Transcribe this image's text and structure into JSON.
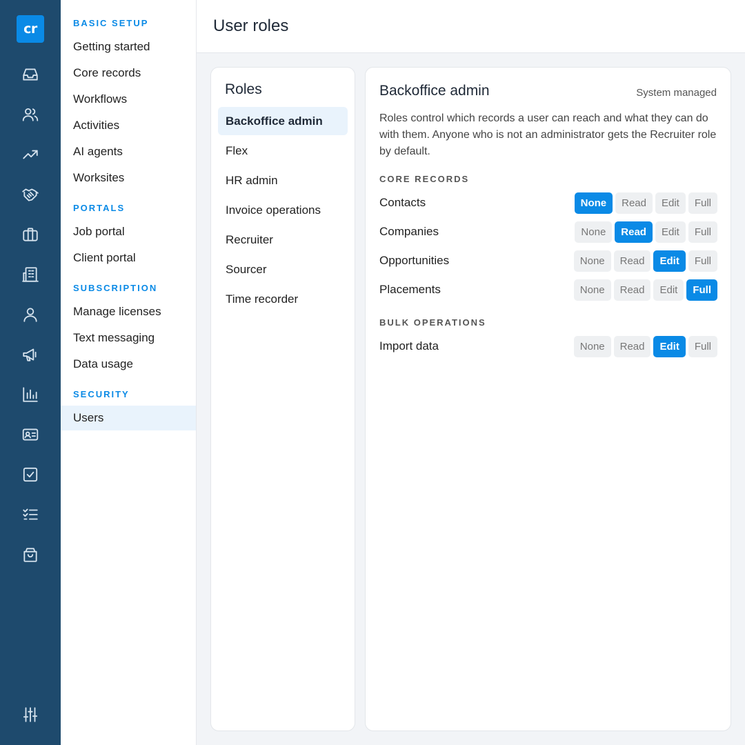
{
  "app": {
    "logo_text": "cr"
  },
  "rail": {
    "icons": [
      "inbox-icon",
      "users-icon",
      "trend-icon",
      "handshake-icon",
      "briefcase-icon",
      "building-icon",
      "user-icon",
      "megaphone-icon",
      "bar-chart-icon",
      "id-card-icon",
      "checkbox-icon",
      "checklist-icon",
      "shopping-bag-icon",
      "sliders-icon"
    ]
  },
  "nav": {
    "sections": [
      {
        "title": "BASIC SETUP",
        "items": [
          "Getting started",
          "Core records",
          "Workflows",
          "Activities",
          "AI agents",
          "Worksites"
        ]
      },
      {
        "title": "PORTALS",
        "items": [
          "Job portal",
          "Client portal"
        ]
      },
      {
        "title": "SUBSCRIPTION",
        "items": [
          "Manage licenses",
          "Text messaging",
          "Data usage"
        ]
      },
      {
        "title": "SECURITY",
        "items": [
          "Users"
        ]
      }
    ],
    "active_item": "Users"
  },
  "header": {
    "title": "User roles"
  },
  "roles": {
    "title": "Roles",
    "items": [
      "Backoffice admin",
      "Flex",
      "HR admin",
      "Invoice operations",
      "Recruiter",
      "Sourcer",
      "Time recorder"
    ],
    "selected": "Backoffice admin"
  },
  "detail": {
    "title": "Backoffice admin",
    "badge": "System managed",
    "description": "Roles control which records a user can reach and what they can do with them. Anyone who is not an administrator gets the Recruiter role by default.",
    "levels": [
      "None",
      "Read",
      "Edit",
      "Full"
    ],
    "groups": [
      {
        "title": "CORE RECORDS",
        "rows": [
          {
            "label": "Contacts",
            "value": "None"
          },
          {
            "label": "Companies",
            "value": "Read"
          },
          {
            "label": "Opportunities",
            "value": "Edit"
          },
          {
            "label": "Placements",
            "value": "Full"
          }
        ]
      },
      {
        "title": "BULK OPERATIONS",
        "rows": [
          {
            "label": "Import data",
            "value": "Edit"
          }
        ]
      }
    ]
  },
  "colors": {
    "accent": "#0a8ae6",
    "rail_bg": "#1e4a6d",
    "active_bg": "#e9f3fc"
  }
}
